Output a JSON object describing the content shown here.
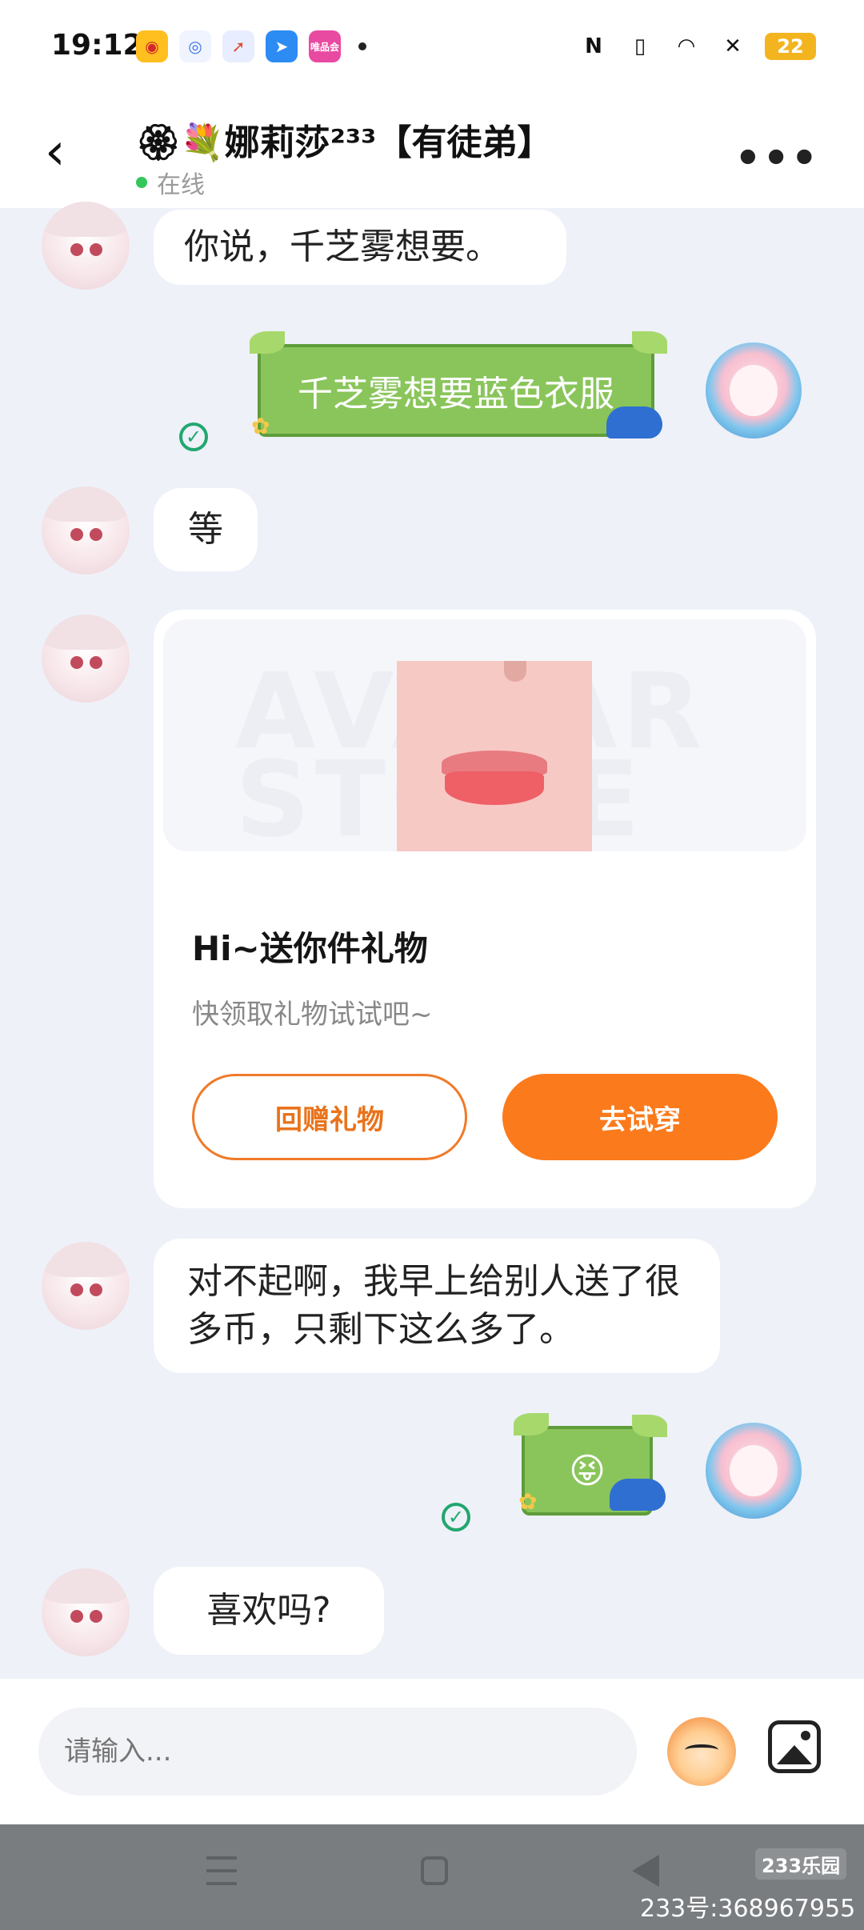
{
  "status_bar": {
    "time": "19:12",
    "battery": "22",
    "apps": [
      {
        "name": "weibo-icon",
        "color": "#ffbf1f"
      },
      {
        "name": "app-eye-icon",
        "color": "#f0f4ff"
      },
      {
        "name": "app-compass-icon",
        "color": "#e8edff"
      },
      {
        "name": "app-feather-icon",
        "color": "#2c8cf4"
      },
      {
        "name": "vipshop-icon",
        "color": "#e84aa2"
      }
    ],
    "vipshop_label": "唯品会"
  },
  "header": {
    "title": "🏵💐娜莉莎²³³【有徒弟】",
    "status": "在线",
    "back_glyph": "‹",
    "more_glyph": "•••"
  },
  "messages": [
    {
      "id": "m1",
      "side": "left",
      "text": "你说，千芝雾想要。"
    },
    {
      "id": "m2",
      "side": "right",
      "text": "千芝雾想要蓝色衣服"
    },
    {
      "id": "m3",
      "side": "left",
      "text": "等"
    },
    {
      "id": "m5",
      "side": "left",
      "text": "对不起啊，我早上给别人送了很多币，只剩下这么多了。"
    },
    {
      "id": "m6",
      "side": "right",
      "text": "😝"
    },
    {
      "id": "m7",
      "side": "left",
      "text": "喜欢吗?"
    }
  ],
  "gift_card": {
    "watermark": "AVATAR STORE",
    "title": "Hi~送你件礼物",
    "subtitle": "快领取礼物试试吧~",
    "btn_return": "回赠礼物",
    "btn_try": "去试穿"
  },
  "input_bar": {
    "placeholder": "请输入..."
  },
  "watermark": {
    "logo": "233乐园",
    "id": "233号:368967955"
  }
}
